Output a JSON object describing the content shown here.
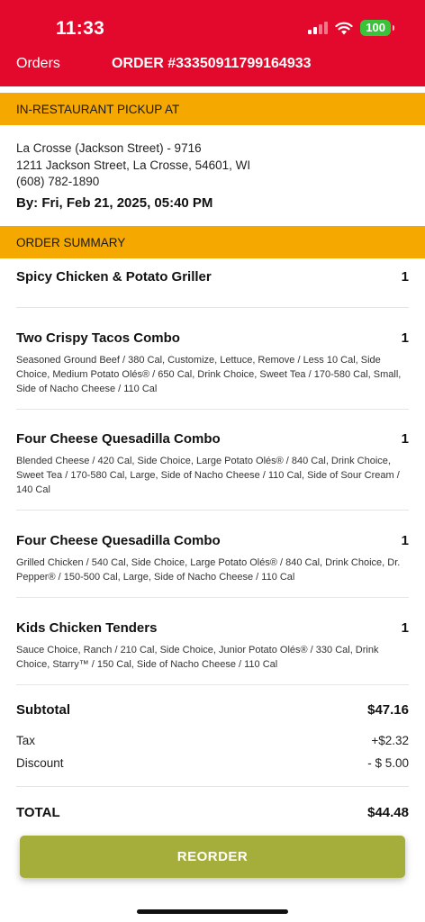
{
  "status_bar": {
    "time": "11:33",
    "battery": "100",
    "icons": [
      "signal-icon",
      "wifi-icon",
      "battery-icon"
    ]
  },
  "nav": {
    "back_label": "Orders",
    "title": "ORDER #33350911799164933"
  },
  "pickup": {
    "header": "IN-RESTAURANT PICKUP AT",
    "store_name": "La Crosse (Jackson Street) - 9716",
    "address": "1211 Jackson Street, La Crosse, 54601, WI",
    "phone": "(608) 782-1890",
    "time": "By: Fri, Feb 21, 2025, 05:40 PM"
  },
  "summary": {
    "header": "ORDER SUMMARY",
    "items": [
      {
        "name": "Spicy Chicken & Potato Griller",
        "qty": "1",
        "desc": ""
      },
      {
        "name": "Two Crispy Tacos Combo",
        "qty": "1",
        "desc": "Seasoned Ground Beef / 380 Cal, Customize, Lettuce, Remove / Less 10 Cal, Side Choice, Medium Potato Olés® / 650 Cal, Drink Choice, Sweet Tea / 170-580 Cal, Small, Side of Nacho Cheese / 110 Cal"
      },
      {
        "name": "Four Cheese Quesadilla Combo",
        "qty": "1",
        "desc": "Blended Cheese / 420 Cal, Side Choice, Large Potato Olés® / 840 Cal, Drink Choice, Sweet Tea / 170-580 Cal, Large, Side of Nacho Cheese / 110 Cal, Side of Sour Cream / 140 Cal"
      },
      {
        "name": "Four Cheese Quesadilla Combo",
        "qty": "1",
        "desc": "Grilled Chicken / 540 Cal, Side Choice, Large Potato Olés® / 840 Cal, Drink Choice, Dr. Pepper® / 150-500 Cal, Large, Side of Nacho Cheese / 110 Cal"
      },
      {
        "name": "Kids Chicken Tenders",
        "qty": "1",
        "desc": "Sauce Choice, Ranch / 210 Cal, Side Choice, Junior Potato Olés® / 330 Cal, Drink Choice, Starry™ / 150 Cal, Side of Nacho Cheese / 110 Cal"
      }
    ]
  },
  "totals": {
    "subtotal_label": "Subtotal",
    "subtotal_value": "$47.16",
    "tax_label": "Tax",
    "tax_value": "+$2.32",
    "discount_label": "Discount",
    "discount_value": "- $ 5.00",
    "total_label": "TOTAL",
    "total_value": "$44.48"
  },
  "actions": {
    "reorder_label": "REORDER"
  },
  "colors": {
    "brand_red": "#e2092c",
    "section_yellow": "#f4a800",
    "button_green": "#a5ae3a",
    "battery_green": "#39c23a"
  }
}
